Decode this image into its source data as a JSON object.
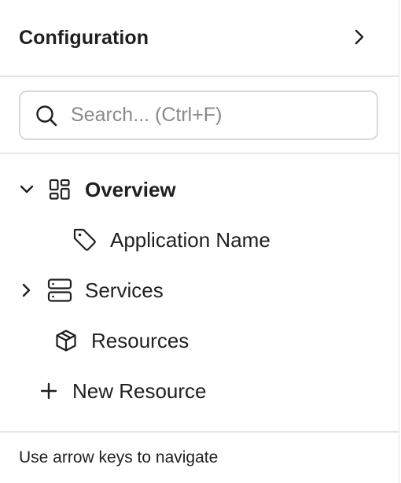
{
  "header": {
    "title": "Configuration",
    "collapse_icon": "chevron-right-icon"
  },
  "search": {
    "placeholder": "Search... (Ctrl+F)",
    "value": "",
    "icon": "search-icon"
  },
  "tree": {
    "items": [
      {
        "label": "Overview",
        "icon": "layout-dashboard-icon",
        "expander": "chevron-down-icon",
        "expanded": true,
        "bold": true
      },
      {
        "label": "Application Name",
        "icon": "tag-icon"
      },
      {
        "label": "Services",
        "icon": "server-icon",
        "expander": "chevron-right-icon",
        "expanded": false
      },
      {
        "label": "Resources",
        "icon": "package-icon"
      },
      {
        "label": "New Resource",
        "icon": "plus-icon"
      }
    ]
  },
  "footer": {
    "hint": "Use arrow keys to navigate"
  },
  "colors": {
    "text": "#1f1f1f",
    "placeholder": "#8a8a8a",
    "border": "#e6e6e6"
  }
}
